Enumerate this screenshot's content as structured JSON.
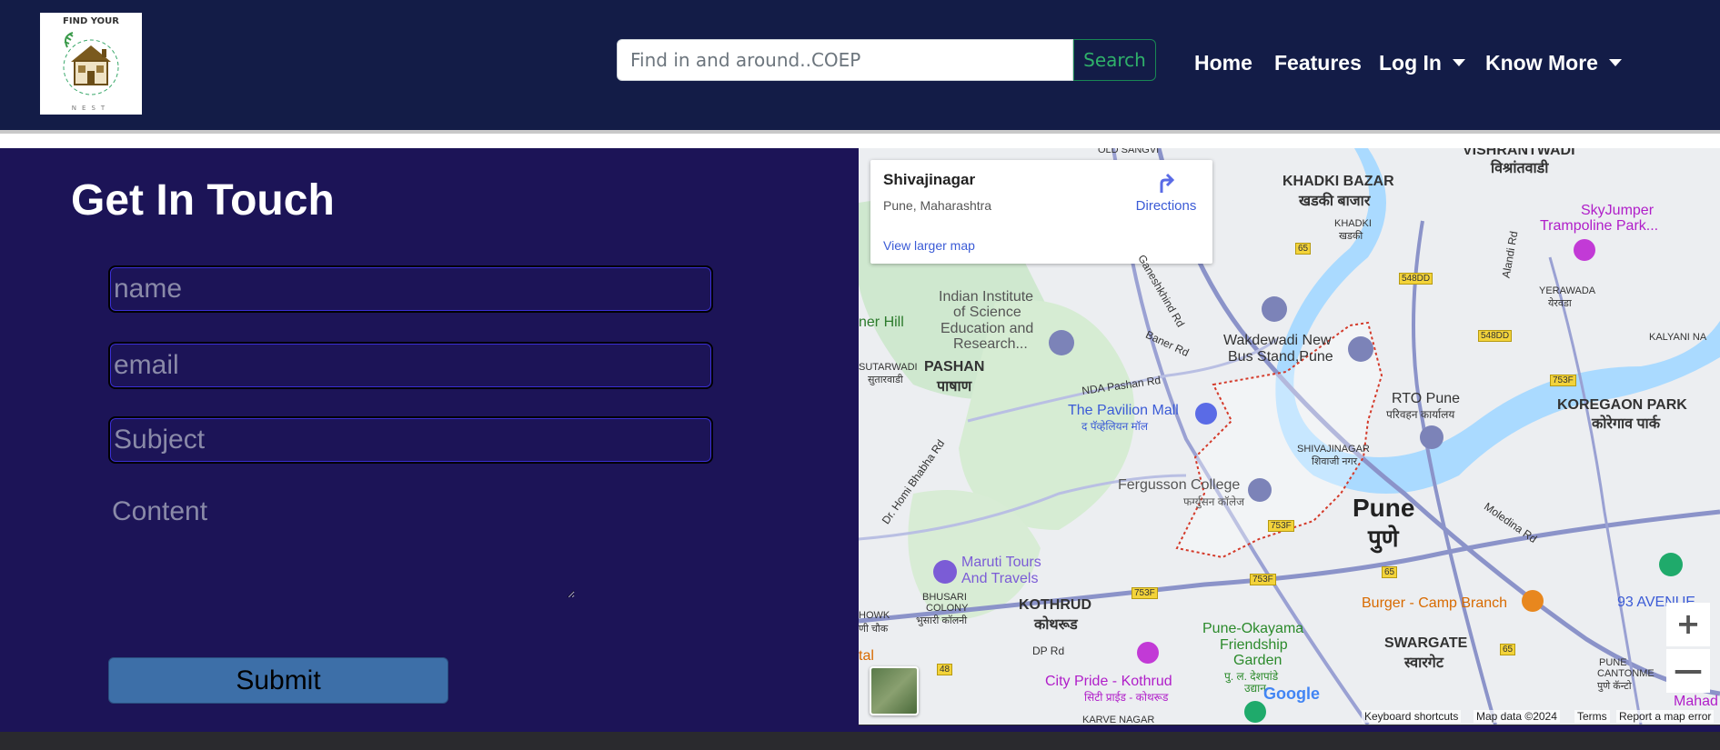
{
  "navbar": {
    "logo_top": "FIND YOUR",
    "logo_bottom": "NEST",
    "search_placeholder": "Find in and around..COEP",
    "search_button": "Search",
    "links": {
      "home": "Home",
      "features": "Features",
      "login": "Log In",
      "know_more": "Know More"
    }
  },
  "contact": {
    "title": "Get In Touch",
    "name_placeholder": "name",
    "email_placeholder": "email",
    "subject_placeholder": "Subject",
    "content_placeholder": "Content",
    "submit_label": "Submit"
  },
  "map": {
    "card": {
      "place": "Shivajinagar",
      "address": "Pune, Maharashtra",
      "directions": "Directions",
      "view_larger": "View larger map"
    },
    "labels": {
      "old_sangvi": "OLD SANGVI",
      "vishrantwadi": "VISHRANTWADI",
      "vishrantwadi_hi": "विश्रांतवाडी",
      "khadki_bazar": "KHADKI BAZAR",
      "khadki_bazar_hi": "खडकी बाजार",
      "khadki": "KHADKI",
      "khadki_hi": "खडकी",
      "skyjumper": "SkyJumper",
      "trampoline": "Trampoline Park...",
      "alandi_rd": "Alandi Rd",
      "yerawada": "YERAWADA",
      "yerawada_hi": "येरवडा",
      "iisc_1": "Indian Institute",
      "iisc_2": "of Science",
      "iisc_3": "Education and",
      "iisc_4": "Research...",
      "ner_hill": "ner Hill",
      "ganeshkhind": "Ganeshkhind Rd",
      "baner_rd": "Baner Rd",
      "wakdewadi_1": "Wakdewadi New",
      "wakdewadi_2": "Bus Stand,Pune",
      "kalyani_nagar": "KALYANI NA",
      "sutarwadi": "SUTARWADI",
      "sutarwadi_hi": "सुतारवाडी",
      "pashan": "PASHAN",
      "pashan_hi": "पाषाण",
      "nda_pashan": "NDA Pashan Rd",
      "pavilion": "The Pavilion Mall",
      "pavilion_hi": "द पॅव्हेलियन मॉल",
      "rto_pune": "RTO Pune",
      "rto_pune_hi": "परिवहन कार्यालय",
      "koregaon_park": "KOREGAON PARK",
      "koregaon_park_hi": "कोरेगाव पार्क",
      "shivajinagar": "SHIVAJINAGAR",
      "shivajinagar_hi": "शिवाजी नगर",
      "homi_bhabha": "Dr. Homi Bhabha Rd",
      "fergusson": "Fergusson College",
      "fergusson_hi": "फर्ग्युसन कॉलेज",
      "pune": "Pune",
      "pune_hi": "पुणे",
      "moledina": "Moledina Rd",
      "maruti_1": "Maruti Tours",
      "maruti_2": "And Travels",
      "bhusari": "BHUSARI",
      "colony": "COLONY",
      "bhusari_hi": "भुसारी कॉलनी",
      "kothrud": "KOTHRUD",
      "kothrud_hi": "कोथरूड",
      "burger": "Burger - Camp Branch",
      "avenue": "93 AVENUE",
      "hows": "HOWK",
      "ani_chowk": "णी चौक",
      "okayama_1": "Pune-Okayama",
      "okayama_2": "Friendship",
      "okayama_3": "Garden",
      "okayama_hi_1": "पु. ल. देशपांडे",
      "okayama_hi_2": "उद्यान",
      "swargate": "SWARGATE",
      "swargate_hi": "स्वारगेट",
      "pune_cantonment": "PUNE",
      "cantonment": "CANTONME",
      "cantonment_hi": "पुणे कॅन्टो",
      "dp_rd": "DP Rd",
      "city_pride": "City Pride - Kothrud",
      "city_pride_hi": "सिटी प्राईड - कोथरूड",
      "karve_nagar": "KARVE NAGAR",
      "ital": "tal",
      "mahad": "Mahad",
      "google": "Google"
    },
    "shields": {
      "r65a": "65",
      "r548dd_a": "548DD",
      "r548dd_b": "548DD",
      "r753f_a": "753F",
      "r753f_b": "753F",
      "r753f_c": "753F",
      "r753f_d": "753F",
      "r65b": "65",
      "r65c": "65",
      "r48": "48"
    },
    "footer": {
      "shortcuts": "Keyboard shortcuts",
      "data": "Map data ©2024",
      "terms": "Terms",
      "report": "Report a map error"
    },
    "zoom_in": "+",
    "zoom_out": "—"
  }
}
